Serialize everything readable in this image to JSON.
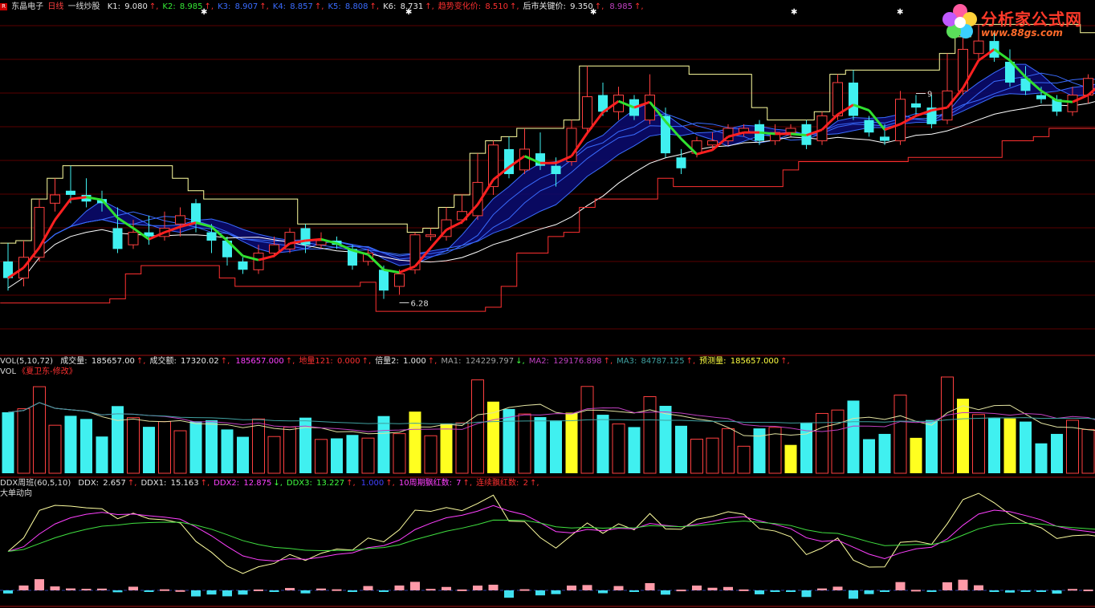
{
  "header": {
    "stock_name": "东晶电子",
    "period": "日线",
    "indicator": "一线炒股",
    "items": [
      {
        "label": "K1: ",
        "value": "9.080",
        "color": "#e8e8e8"
      },
      {
        "label": "K2: ",
        "value": "8.985",
        "color": "#35e835"
      },
      {
        "label": "K3: ",
        "value": "8.907",
        "color": "#3a6cff"
      },
      {
        "label": "K4: ",
        "value": "8.857",
        "color": "#3a6cff"
      },
      {
        "label": "K5: ",
        "value": "8.808",
        "color": "#3a6cff"
      },
      {
        "label": "K6: ",
        "value": "8.731",
        "color": "#e8e8e8"
      },
      {
        "label": "趋势变化价: ",
        "value": "8.510",
        "color": "#ff3030"
      },
      {
        "label": "后市关键价: ",
        "value": "9.350",
        "color": "#e8e8e8"
      },
      {
        "label": "",
        "value": "8.985",
        "color": "#c040c0"
      }
    ]
  },
  "vol_header": {
    "name": "VOL(5,10,72)",
    "items": [
      {
        "label": "成交量: ",
        "value": "185657.00",
        "color": "#e8e8e8"
      },
      {
        "label": "成交额: ",
        "value": "17320.02",
        "color": "#e8e8e8"
      },
      {
        "label": "",
        "value": "185657.000",
        "color": "#ff40ff"
      },
      {
        "label": "地量121: ",
        "value": "0.000",
        "color": "#ff3030"
      },
      {
        "label": "倍量2: ",
        "value": "1.000",
        "color": "#e8e8e8"
      },
      {
        "label": "MA1: ",
        "value": "124229.797",
        "color": "#a0a0a0"
      },
      {
        "label": "MA2: ",
        "value": "129176.898",
        "color": "#c040c0"
      },
      {
        "label": "MA3: ",
        "value": "84787.125",
        "color": "#40a0a0"
      },
      {
        "label": "预测量: ",
        "value": "185657.000",
        "color": "#ffff40"
      }
    ],
    "subtitle_prefix": "VOL",
    "subtitle": "《夏卫东-修改》"
  },
  "ddx_header": {
    "name": "DDX周班(60,5,10)",
    "items": [
      {
        "label": "DDX: ",
        "value": "2.657",
        "color": "#e8e8e8"
      },
      {
        "label": "DDX1: ",
        "value": "15.163",
        "color": "#e8e8e8"
      },
      {
        "label": "DDX2: ",
        "value": "12.875",
        "color": "#ff40ff"
      },
      {
        "label": "DDX3: ",
        "value": "13.227",
        "color": "#40ff40"
      },
      {
        "label": "",
        "value": "1.000",
        "color": "#4040ff"
      },
      {
        "label": "10周期飘红数: ",
        "value": "7",
        "color": "#ff40ff"
      },
      {
        "label": "连续飘红数: ",
        "value": "2",
        "color": "#ff3030"
      }
    ],
    "subtitle": "大单动向"
  },
  "arrows": {
    "up": "↑",
    "down": "↓"
  },
  "logo": {
    "text": "分析家公式网",
    "url": "www.88gs.com"
  },
  "chart_data": {
    "type": "candlestick",
    "price_annotations": [
      {
        "label": "6.28",
        "index": 25
      },
      {
        "label": "9",
        "index": 58
      }
    ],
    "candles": [
      [
        7.3,
        7.1,
        7.52,
        6.95
      ],
      [
        7.1,
        7.35,
        7.55,
        7.0
      ],
      [
        7.35,
        7.95,
        8.05,
        7.3
      ],
      [
        8.0,
        8.1,
        8.3,
        7.9
      ],
      [
        8.15,
        8.1,
        8.45,
        8.0
      ],
      [
        8.1,
        8.02,
        8.3,
        7.95
      ],
      [
        8.05,
        8.0,
        8.15,
        7.9
      ],
      [
        7.7,
        7.45,
        7.95,
        7.4
      ],
      [
        7.5,
        7.65,
        7.8,
        7.45
      ],
      [
        7.65,
        7.6,
        7.85,
        7.5
      ],
      [
        7.6,
        7.7,
        7.9,
        7.55
      ],
      [
        7.75,
        7.85,
        7.95,
        7.6
      ],
      [
        8.0,
        7.75,
        8.05,
        7.65
      ],
      [
        7.65,
        7.55,
        7.75,
        7.4
      ],
      [
        7.55,
        7.35,
        7.6,
        7.25
      ],
      [
        7.3,
        7.2,
        7.35,
        7.15
      ],
      [
        7.2,
        7.4,
        7.5,
        7.15
      ],
      [
        7.4,
        7.5,
        7.6,
        7.35
      ],
      [
        7.45,
        7.65,
        7.7,
        7.4
      ],
      [
        7.7,
        7.5,
        7.75,
        7.4
      ],
      [
        7.5,
        7.55,
        7.65,
        7.45
      ],
      [
        7.55,
        7.5,
        7.6,
        7.45
      ],
      [
        7.45,
        7.25,
        7.5,
        7.2
      ],
      [
        7.3,
        7.4,
        7.45,
        7.25
      ],
      [
        7.2,
        6.95,
        7.25,
        6.85
      ],
      [
        7.0,
        7.15,
        7.2,
        6.9
      ],
      [
        7.2,
        7.62,
        7.65,
        7.15
      ],
      [
        7.6,
        7.62,
        7.7,
        7.55
      ],
      [
        7.6,
        7.8,
        7.95,
        7.55
      ],
      [
        7.8,
        7.9,
        8.1,
        7.75
      ],
      [
        7.85,
        8.25,
        8.6,
        7.8
      ],
      [
        8.2,
        8.7,
        8.75,
        8.1
      ],
      [
        8.65,
        8.35,
        8.8,
        8.3
      ],
      [
        8.4,
        8.65,
        8.9,
        8.35
      ],
      [
        8.6,
        8.45,
        8.85,
        8.4
      ],
      [
        8.45,
        8.35,
        8.55,
        8.2
      ],
      [
        8.5,
        8.9,
        9.0,
        8.45
      ],
      [
        8.9,
        9.28,
        9.65,
        8.85
      ],
      [
        9.3,
        9.1,
        9.45,
        9.05
      ],
      [
        9.1,
        9.3,
        9.4,
        9.0
      ],
      [
        9.25,
        9.05,
        9.3,
        9.0
      ],
      [
        9.0,
        9.3,
        9.55,
        8.95
      ],
      [
        9.05,
        8.6,
        9.15,
        8.55
      ],
      [
        8.55,
        8.42,
        8.65,
        8.35
      ],
      [
        8.6,
        8.75,
        8.8,
        8.55
      ],
      [
        8.7,
        8.75,
        8.85,
        8.65
      ],
      [
        8.75,
        8.9,
        8.95,
        8.7
      ],
      [
        8.85,
        8.9,
        8.95,
        8.8
      ],
      [
        8.95,
        8.75,
        9.0,
        8.7
      ],
      [
        8.75,
        8.85,
        8.95,
        8.7
      ],
      [
        8.85,
        8.9,
        8.95,
        8.8
      ],
      [
        8.95,
        8.7,
        9.0,
        8.65
      ],
      [
        8.75,
        9.05,
        9.1,
        8.7
      ],
      [
        9.05,
        9.45,
        9.55,
        9.0
      ],
      [
        9.45,
        9.05,
        9.6,
        9.0
      ],
      [
        9.0,
        8.85,
        9.05,
        8.8
      ],
      [
        8.8,
        8.75,
        8.95,
        8.7
      ],
      [
        8.75,
        9.25,
        9.35,
        8.7
      ],
      [
        9.2,
        9.15,
        9.3,
        9.05
      ],
      [
        9.15,
        8.95,
        9.3,
        8.9
      ],
      [
        9.0,
        9.35,
        9.8,
        8.95
      ],
      [
        9.35,
        9.85,
        10.0,
        9.3
      ],
      [
        9.8,
        9.95,
        10.15,
        9.7
      ],
      [
        9.95,
        9.75,
        10.05,
        9.7
      ],
      [
        9.7,
        9.45,
        9.85,
        9.4
      ],
      [
        9.5,
        9.35,
        9.65,
        9.3
      ],
      [
        9.3,
        9.25,
        9.4,
        9.2
      ],
      [
        9.25,
        9.1,
        9.3,
        9.05
      ],
      [
        9.1,
        9.3,
        9.4,
        9.05
      ],
      [
        9.3,
        9.5,
        9.55,
        9.2
      ],
      [
        9.45,
        9.6,
        9.7,
        9.4
      ],
      [
        9.6,
        9.3,
        9.75,
        9.25
      ]
    ]
  }
}
